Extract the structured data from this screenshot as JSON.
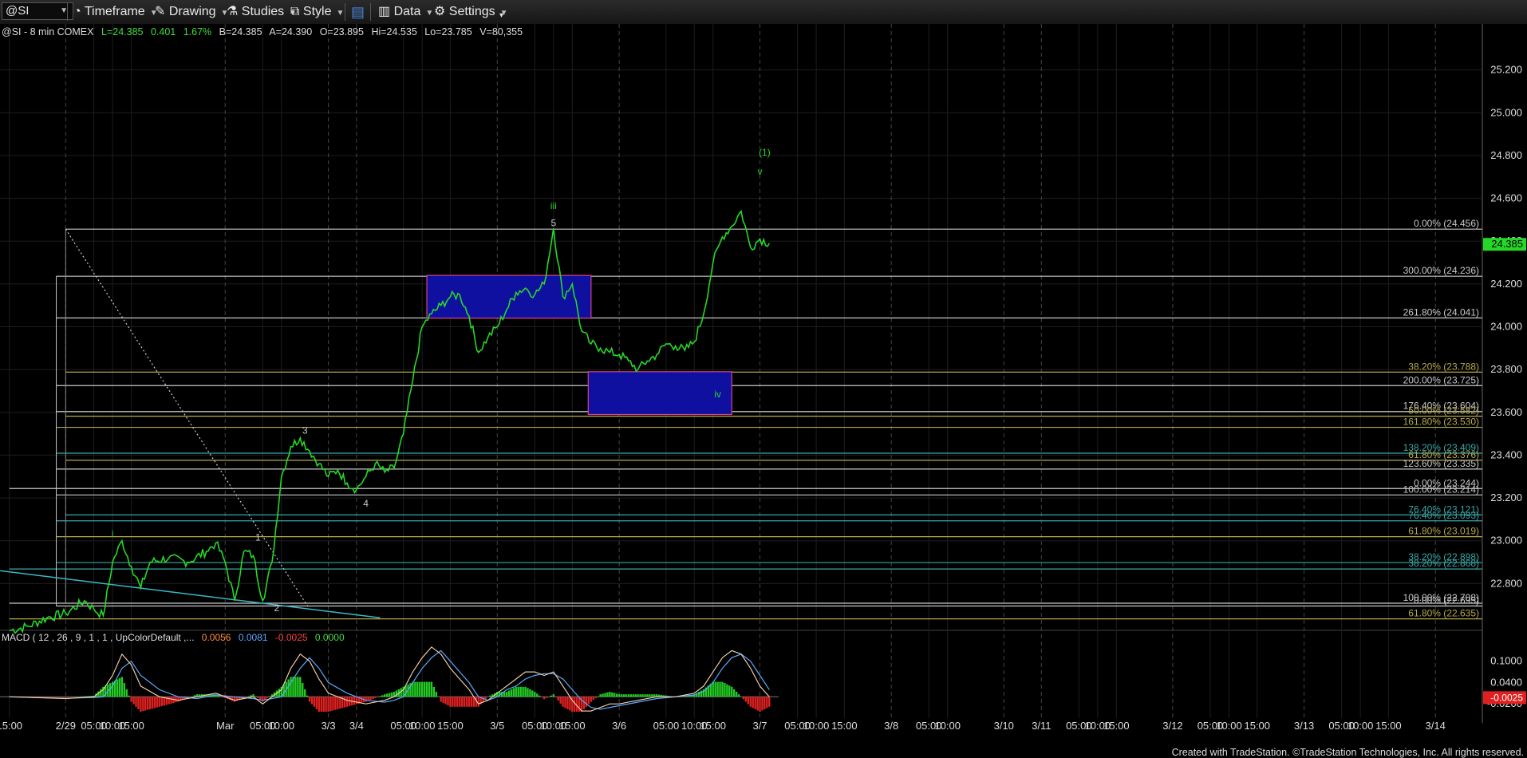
{
  "toolbar": {
    "symbol": "@SI",
    "timeframe": "Timeframe",
    "drawing": "Drawing",
    "studies": "Studies",
    "style": "Style",
    "data": "Data",
    "settings": "Settings"
  },
  "info_bar": {
    "symbol_desc": "@SI - 8 min  COMEX",
    "last": "L=24.385",
    "change": "0.401",
    "change_pct": "1.67%",
    "bid": "B=24.385",
    "ask": "A=24.390",
    "open": "O=23.895",
    "high": "Hi=24.535",
    "low": "Lo=23.785",
    "volume": "V=80,355"
  },
  "macd_label": {
    "title": "MACD ( 12 , 26 , 9 , 1 , 1 , UpColorDefault ,...",
    "v1": "0.0056",
    "v2": "0.0081",
    "v3": "-0.0025",
    "v4": "0.0000"
  },
  "footer": "Created with TradeStation. ©TradeStation Technologies, Inc. All rights reserved.",
  "colors": {
    "price": "#26d826",
    "fib_white": "#c8c8c8",
    "fib_olive": "#b5a94a",
    "fib_teal": "#3aa7a7",
    "box_fill": "#1010a0",
    "box_border": "#d8408a",
    "macd_up": "#22cc22",
    "macd_down": "#e02020"
  },
  "chart_data": {
    "type": "line",
    "title": "",
    "ylim": [
      22.6,
      25.4
    ],
    "price_axis_ticks": [
      "25.200",
      "25.000",
      "24.800",
      "24.600",
      "24.400",
      "24.200",
      "24.000",
      "23.800",
      "23.600",
      "23.400",
      "23.200",
      "23.000",
      "22.800"
    ],
    "last_price": "24.385",
    "x_ticks": [
      {
        "i": 0,
        "label": "15:00"
      },
      {
        "i": 6,
        "label": "2/29"
      },
      {
        "i": 9,
        "label": "05:00"
      },
      {
        "i": 11,
        "label": "10:00"
      },
      {
        "i": 13,
        "label": "15:00"
      },
      {
        "i": 23,
        "label": "Mar"
      },
      {
        "i": 27,
        "label": "05:00"
      },
      {
        "i": 29,
        "label": "10:00"
      },
      {
        "i": 34,
        "label": "3/3"
      },
      {
        "i": 37,
        "label": "3/4"
      },
      {
        "i": 42,
        "label": "05:00"
      },
      {
        "i": 44,
        "label": "10:00"
      },
      {
        "i": 47,
        "label": "15:00"
      },
      {
        "i": 52,
        "label": "3/5"
      },
      {
        "i": 56,
        "label": "05:00"
      },
      {
        "i": 58,
        "label": "10:00"
      },
      {
        "i": 60,
        "label": "15:00"
      },
      {
        "i": 65,
        "label": "3/6"
      },
      {
        "i": 70,
        "label": "05:00"
      },
      {
        "i": 73,
        "label": "10:00"
      },
      {
        "i": 75,
        "label": "15:00"
      },
      {
        "i": 80,
        "label": "3/7"
      },
      {
        "i": 84,
        "label": "05:00"
      },
      {
        "i": 86,
        "label": "10:00"
      },
      {
        "i": 89,
        "label": "15:00"
      },
      {
        "i": 94,
        "label": "3/8"
      },
      {
        "i": 98,
        "label": "05:00"
      },
      {
        "i": 100,
        "label": "10:00"
      },
      {
        "i": 106,
        "label": "3/10"
      },
      {
        "i": 110,
        "label": "3/11"
      },
      {
        "i": 114,
        "label": "05:00"
      },
      {
        "i": 116,
        "label": "10:00"
      },
      {
        "i": 118,
        "label": "15:00"
      },
      {
        "i": 124,
        "label": "3/12"
      },
      {
        "i": 128,
        "label": "05:00"
      },
      {
        "i": 130,
        "label": "10:00"
      },
      {
        "i": 133,
        "label": "15:00"
      },
      {
        "i": 138,
        "label": "3/13"
      },
      {
        "i": 142,
        "label": "05:00"
      },
      {
        "i": 144,
        "label": "10:00"
      },
      {
        "i": 147,
        "label": "15:00"
      },
      {
        "i": 152,
        "label": "3/14"
      }
    ],
    "x_range": [
      -1,
      157
    ],
    "series": [
      {
        "values": [
          [
            0,
            22.58
          ],
          [
            2,
            22.6
          ],
          [
            4,
            22.64
          ],
          [
            6,
            22.66
          ],
          [
            8,
            22.72
          ],
          [
            9,
            22.68
          ],
          [
            10,
            22.65
          ],
          [
            11,
            22.9
          ],
          [
            12,
            23.0
          ],
          [
            13,
            22.88
          ],
          [
            14,
            22.78
          ],
          [
            15,
            22.9
          ],
          [
            17,
            22.92
          ],
          [
            19,
            22.9
          ],
          [
            21,
            22.95
          ],
          [
            22,
            22.99
          ],
          [
            23,
            22.9
          ],
          [
            24,
            22.72
          ],
          [
            25,
            22.95
          ],
          [
            26,
            22.93
          ],
          [
            27,
            22.72
          ],
          [
            28,
            22.9
          ],
          [
            29,
            23.3
          ],
          [
            30,
            23.44
          ],
          [
            31,
            23.48
          ],
          [
            32,
            23.42
          ],
          [
            33,
            23.36
          ],
          [
            34,
            23.3
          ],
          [
            35,
            23.33
          ],
          [
            36,
            23.27
          ],
          [
            37,
            23.24
          ],
          [
            38,
            23.3
          ],
          [
            39,
            23.36
          ],
          [
            40,
            23.32
          ],
          [
            41,
            23.34
          ],
          [
            42,
            23.5
          ],
          [
            43,
            23.75
          ],
          [
            44,
            24.0
          ],
          [
            45,
            24.06
          ],
          [
            46,
            24.1
          ],
          [
            47,
            24.14
          ],
          [
            48,
            24.15
          ],
          [
            49,
            24.05
          ],
          [
            50,
            23.88
          ],
          [
            51,
            23.95
          ],
          [
            52,
            24.0
          ],
          [
            53,
            24.08
          ],
          [
            54,
            24.16
          ],
          [
            55,
            24.18
          ],
          [
            56,
            24.15
          ],
          [
            57,
            24.2
          ],
          [
            58,
            24.46
          ],
          [
            59,
            24.14
          ],
          [
            60,
            24.2
          ],
          [
            61,
            23.98
          ],
          [
            62,
            23.92
          ],
          [
            63,
            23.9
          ],
          [
            64,
            23.88
          ],
          [
            65,
            23.87
          ],
          [
            66,
            23.84
          ],
          [
            67,
            23.8
          ],
          [
            68,
            23.84
          ],
          [
            69,
            23.87
          ],
          [
            70,
            23.92
          ],
          [
            71,
            23.91
          ],
          [
            72,
            23.89
          ],
          [
            73,
            23.93
          ],
          [
            74,
            24.06
          ],
          [
            75,
            24.3
          ],
          [
            76,
            24.42
          ],
          [
            77,
            24.47
          ],
          [
            78,
            24.54
          ],
          [
            79,
            24.37
          ],
          [
            80,
            24.41
          ],
          [
            81,
            24.39
          ]
        ]
      }
    ],
    "macd": {
      "ylim": [
        -0.06,
        0.16
      ],
      "ticks": [
        "0.1000",
        "0.0400",
        "-0.0200"
      ],
      "last": "-0.0025",
      "line": [
        [
          0,
          0.0
        ],
        [
          6,
          -0.005
        ],
        [
          9,
          0.0
        ],
        [
          10,
          0.02
        ],
        [
          11,
          0.06
        ],
        [
          12,
          0.12
        ],
        [
          13,
          0.09
        ],
        [
          14,
          0.03
        ],
        [
          16,
          0.0
        ],
        [
          18,
          -0.01
        ],
        [
          20,
          0.0
        ],
        [
          22,
          0.01
        ],
        [
          24,
          -0.01
        ],
        [
          26,
          0.0
        ],
        [
          27,
          -0.02
        ],
        [
          29,
          0.02
        ],
        [
          30,
          0.08
        ],
        [
          31,
          0.12
        ],
        [
          32,
          0.1
        ],
        [
          33,
          0.05
        ],
        [
          34,
          0.01
        ],
        [
          36,
          -0.01
        ],
        [
          38,
          -0.02
        ],
        [
          40,
          -0.01
        ],
        [
          41,
          0.0
        ],
        [
          42,
          0.02
        ],
        [
          43,
          0.07
        ],
        [
          44,
          0.11
        ],
        [
          45,
          0.14
        ],
        [
          46,
          0.12
        ],
        [
          47,
          0.08
        ],
        [
          48,
          0.05
        ],
        [
          49,
          0.02
        ],
        [
          50,
          -0.02
        ],
        [
          51,
          -0.01
        ],
        [
          52,
          0.01
        ],
        [
          53,
          0.03
        ],
        [
          54,
          0.05
        ],
        [
          55,
          0.07
        ],
        [
          56,
          0.07
        ],
        [
          57,
          0.06
        ],
        [
          58,
          0.07
        ],
        [
          59,
          0.03
        ],
        [
          60,
          -0.01
        ],
        [
          61,
          -0.04
        ],
        [
          62,
          -0.04
        ],
        [
          63,
          -0.03
        ],
        [
          64,
          -0.02
        ],
        [
          65,
          -0.02
        ],
        [
          67,
          -0.01
        ],
        [
          69,
          0.0
        ],
        [
          71,
          0.0
        ],
        [
          73,
          0.01
        ],
        [
          74,
          0.03
        ],
        [
          75,
          0.07
        ],
        [
          76,
          0.11
        ],
        [
          77,
          0.13
        ],
        [
          78,
          0.12
        ],
        [
          79,
          0.08
        ],
        [
          80,
          0.03
        ],
        [
          81,
          0.0
        ]
      ],
      "signal": [
        [
          0,
          0.0
        ],
        [
          6,
          -0.004
        ],
        [
          9,
          -0.002
        ],
        [
          10,
          0.0
        ],
        [
          11,
          0.03
        ],
        [
          12,
          0.08
        ],
        [
          13,
          0.1
        ],
        [
          14,
          0.06
        ],
        [
          16,
          0.02
        ],
        [
          18,
          0.0
        ],
        [
          20,
          -0.005
        ],
        [
          22,
          0.005
        ],
        [
          24,
          0.0
        ],
        [
          26,
          -0.005
        ],
        [
          27,
          -0.01
        ],
        [
          29,
          0.0
        ],
        [
          30,
          0.04
        ],
        [
          31,
          0.08
        ],
        [
          32,
          0.11
        ],
        [
          33,
          0.08
        ],
        [
          34,
          0.04
        ],
        [
          36,
          0.01
        ],
        [
          38,
          -0.01
        ],
        [
          40,
          -0.015
        ],
        [
          41,
          -0.01
        ],
        [
          42,
          0.0
        ],
        [
          43,
          0.04
        ],
        [
          44,
          0.08
        ],
        [
          45,
          0.11
        ],
        [
          46,
          0.13
        ],
        [
          47,
          0.1
        ],
        [
          48,
          0.07
        ],
        [
          49,
          0.04
        ],
        [
          50,
          0.0
        ],
        [
          51,
          -0.01
        ],
        [
          52,
          0.0
        ],
        [
          53,
          0.02
        ],
        [
          54,
          0.03
        ],
        [
          55,
          0.05
        ],
        [
          56,
          0.06
        ],
        [
          57,
          0.065
        ],
        [
          58,
          0.065
        ],
        [
          59,
          0.05
        ],
        [
          60,
          0.02
        ],
        [
          61,
          -0.01
        ],
        [
          62,
          -0.03
        ],
        [
          63,
          -0.035
        ],
        [
          64,
          -0.03
        ],
        [
          65,
          -0.025
        ],
        [
          67,
          -0.015
        ],
        [
          69,
          -0.005
        ],
        [
          71,
          0.0
        ],
        [
          73,
          0.005
        ],
        [
          74,
          0.015
        ],
        [
          75,
          0.04
        ],
        [
          76,
          0.08
        ],
        [
          77,
          0.11
        ],
        [
          78,
          0.12
        ],
        [
          79,
          0.1
        ],
        [
          80,
          0.06
        ],
        [
          81,
          0.02
        ]
      ]
    },
    "fib_lines": [
      {
        "price": 24.456,
        "label": "0.00% (24.456)",
        "color": "white",
        "x0": 6
      },
      {
        "price": 24.236,
        "label": "300.00% (24.236)",
        "color": "white",
        "x0": 5
      },
      {
        "price": 24.041,
        "label": "261.80% (24.041)",
        "color": "white",
        "x0": 5
      },
      {
        "price": 23.788,
        "label": "38.20% (23.788)",
        "color": "olive",
        "x0": 6
      },
      {
        "price": 23.725,
        "label": "200.00% (23.725)",
        "color": "white",
        "x0": 5
      },
      {
        "price": 23.604,
        "label": "176.40% (23.604)",
        "color": "white",
        "x0": 5
      },
      {
        "price": 23.582,
        "label": "50.00% (23.582)",
        "color": "olive",
        "x0": 6
      },
      {
        "price": 23.53,
        "label": "161.80% (23.530)",
        "color": "olive",
        "x0": 5
      },
      {
        "price": 23.409,
        "label": "138.20% (23.409)",
        "color": "teal",
        "x0": 5
      },
      {
        "price": 23.376,
        "label": "61.80% (23.376)",
        "color": "olive",
        "x0": 6
      },
      {
        "price": 23.335,
        "label": "123.60% (23.335)",
        "color": "white",
        "x0": 5
      },
      {
        "price": 23.244,
        "label": "0.00% (23.244)",
        "color": "white",
        "x0": 0
      },
      {
        "price": 23.214,
        "label": "100.00% (23.214)",
        "color": "white",
        "x0": 5
      },
      {
        "price": 23.121,
        "label": "76.40% (23.121)",
        "color": "teal",
        "x0": 6
      },
      {
        "price": 23.093,
        "label": "76.40% (23.093)",
        "color": "teal",
        "x0": 5
      },
      {
        "price": 23.019,
        "label": "61.80% (23.019)",
        "color": "olive",
        "x0": 5
      },
      {
        "price": 22.898,
        "label": "38.20% (22.898)",
        "color": "teal",
        "x0": 5
      },
      {
        "price": 22.868,
        "label": "38.20% (22.868)",
        "color": "teal",
        "x0": 0
      },
      {
        "price": 22.708,
        "label": "100.00% (22.708)",
        "color": "white",
        "x0": 0
      },
      {
        "price": 22.695,
        "label": "0.00% (22.695)",
        "color": "white",
        "x0": 5
      },
      {
        "price": 22.635,
        "label": "61.80% (22.635)",
        "color": "olive",
        "x0": 0
      }
    ],
    "boxes": [
      {
        "x0": 44.5,
        "x1": 62,
        "y0": 24.04,
        "y1": 24.24
      },
      {
        "x0": 61.7,
        "x1": 77,
        "y0": 23.59,
        "y1": 23.79
      }
    ],
    "wave_labels": [
      {
        "x": 11,
        "y": 23.02,
        "text": "i",
        "color": "green"
      },
      {
        "x": 26.5,
        "y": 23.0,
        "text": "1",
        "color": "white"
      },
      {
        "x": 28.5,
        "y": 22.67,
        "text": "2",
        "color": "white"
      },
      {
        "x": 31.5,
        "y": 23.5,
        "text": "3",
        "color": "white"
      },
      {
        "x": 38,
        "y": 23.16,
        "text": "4",
        "color": "white"
      },
      {
        "x": 58,
        "y": 24.47,
        "text": "5",
        "color": "white"
      },
      {
        "x": 58,
        "y": 24.55,
        "text": "iii",
        "color": "green"
      },
      {
        "x": 75.5,
        "y": 23.67,
        "text": "iv",
        "color": "green"
      },
      {
        "x": 80,
        "y": 24.71,
        "text": "v",
        "color": "green"
      },
      {
        "x": 80.5,
        "y": 24.8,
        "text": "(1)",
        "color": "green"
      }
    ]
  }
}
